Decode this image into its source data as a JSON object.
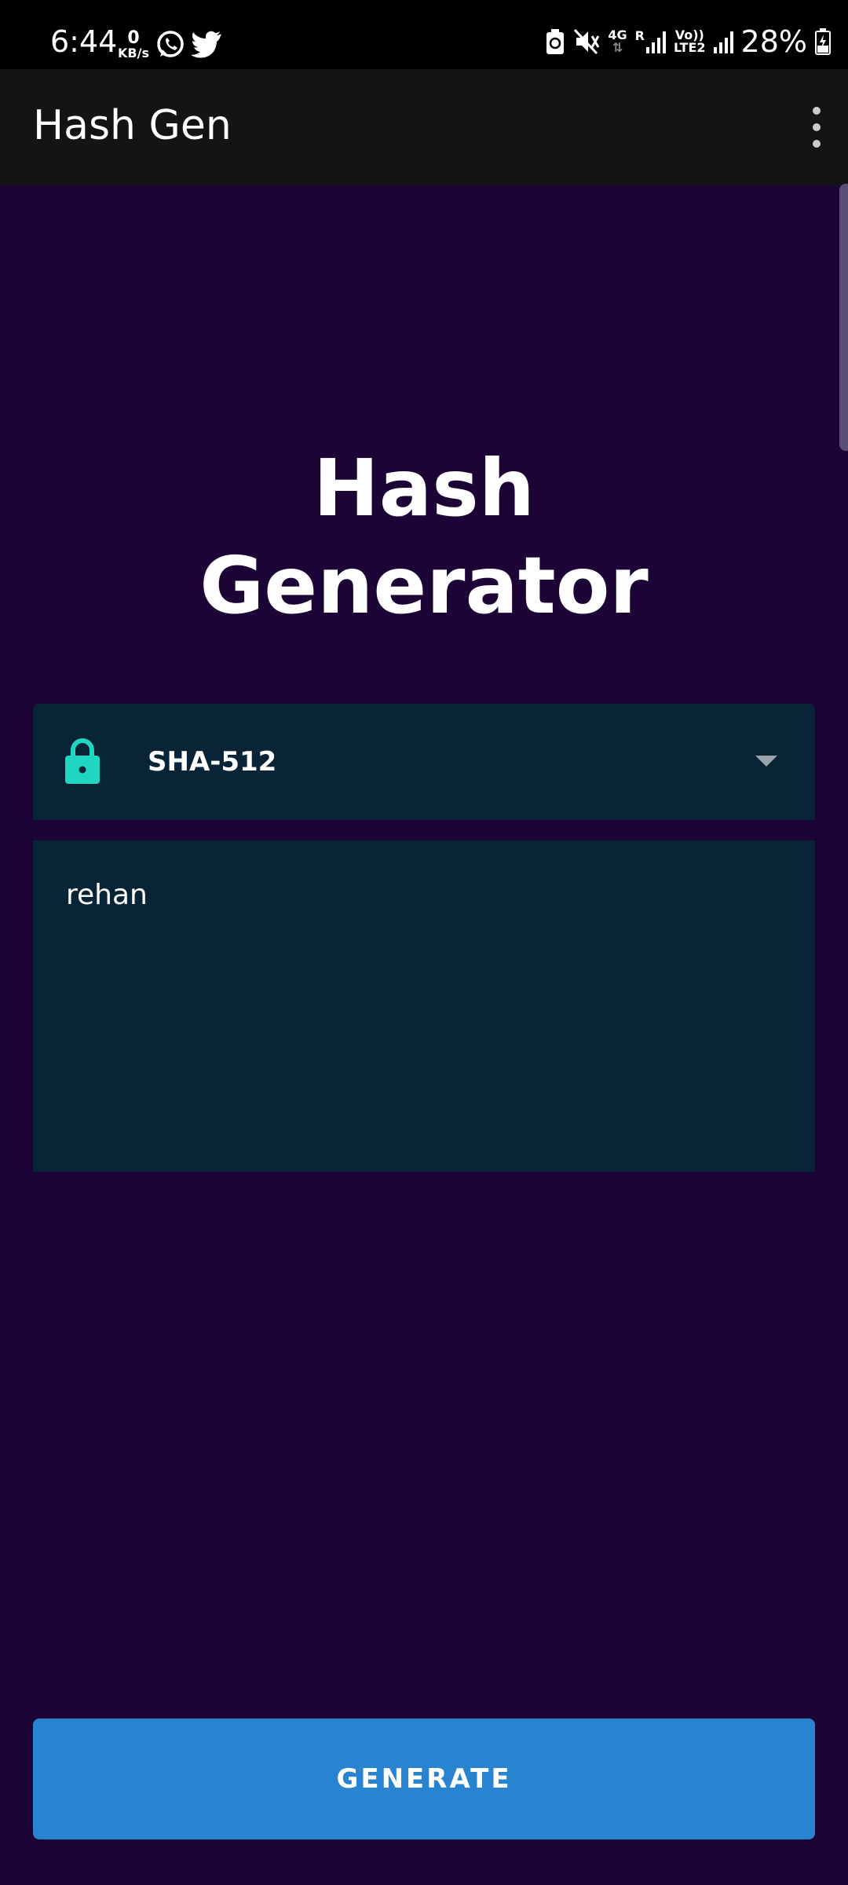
{
  "status_bar": {
    "time": "6:44",
    "net_speed_value": "0",
    "net_speed_unit": "KB/s",
    "network_4g": "4G",
    "roaming": "R",
    "volte": "Vo))",
    "lte2": "LTE2",
    "battery": "28%",
    "icons": [
      "whatsapp-icon",
      "twitter-icon",
      "battery-saver-icon",
      "mute-icon",
      "signal-icon",
      "signal-icon-2",
      "battery-charging-icon"
    ]
  },
  "app_bar": {
    "title": "Hash Gen",
    "menu_icon": "overflow-menu-icon"
  },
  "main": {
    "heading_line1": "Hash",
    "heading_line2": "Generator",
    "algorithm": {
      "icon": "lock-icon",
      "selected": "SHA-512",
      "dropdown_icon": "dropdown-arrow-icon"
    },
    "input_text": "rehan",
    "generate_label": "GENERATE"
  },
  "colors": {
    "background": "#1d0437",
    "app_bar": "#141414",
    "field_background": "#0a2437",
    "accent_teal": "#1ed6c2",
    "button_blue": "#2884d1"
  }
}
